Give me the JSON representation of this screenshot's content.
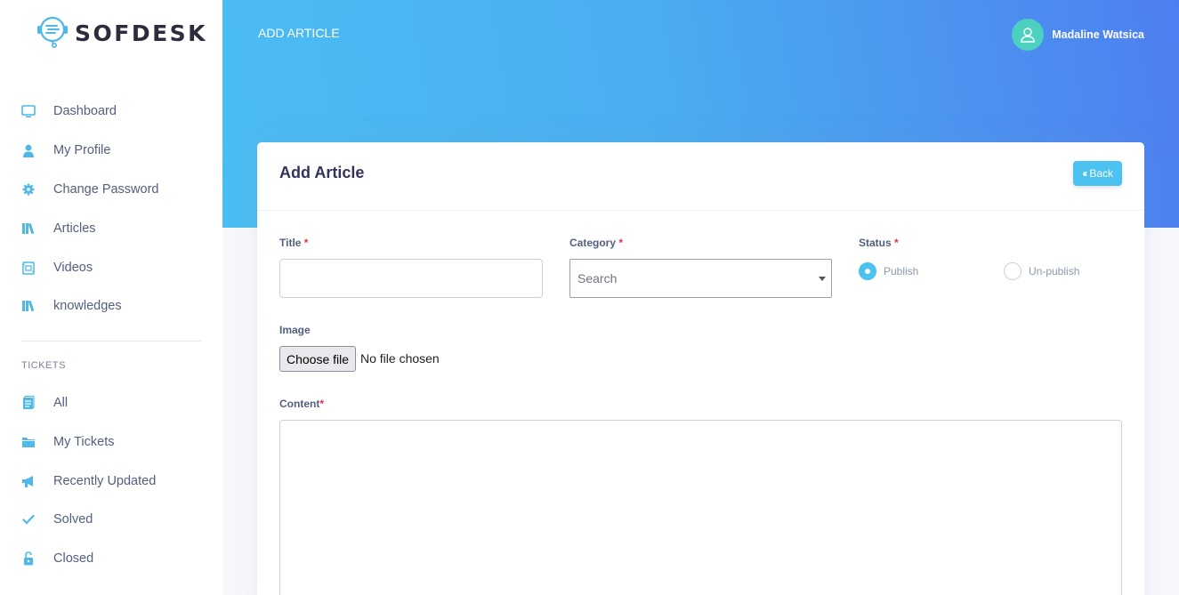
{
  "brand": {
    "name": "SOFDESK"
  },
  "sidebar": {
    "items": [
      {
        "label": "Dashboard",
        "icon": "monitor-icon"
      },
      {
        "label": "My Profile",
        "icon": "user-icon"
      },
      {
        "label": "Change Password",
        "icon": "gear-icon"
      },
      {
        "label": "Articles",
        "icon": "books-icon"
      },
      {
        "label": "Videos",
        "icon": "video-icon"
      },
      {
        "label": "knowledges",
        "icon": "books-icon"
      }
    ],
    "tickets_heading": "TICKETS",
    "ticket_items": [
      {
        "label": "All",
        "icon": "document-icon"
      },
      {
        "label": "My Tickets",
        "icon": "folder-icon"
      },
      {
        "label": "Recently Updated",
        "icon": "megaphone-icon"
      },
      {
        "label": "Solved",
        "icon": "check-icon"
      },
      {
        "label": "Closed",
        "icon": "unlock-icon"
      }
    ]
  },
  "header": {
    "title": "ADD ARTICLE"
  },
  "user": {
    "name": "Madaline Watsica"
  },
  "card": {
    "title": "Add Article",
    "back_label": "Back"
  },
  "form": {
    "title_label": "Title",
    "title_value": "",
    "category_label": "Category",
    "category_placeholder": "Search",
    "status_label": "Status",
    "status_options": [
      "Publish",
      "Un-publish"
    ],
    "status_selected": "Publish",
    "image_label": "Image",
    "file_button": "Choose file",
    "file_status": "No file chosen",
    "content_label": "Content",
    "required_mark": "*"
  },
  "colors": {
    "accent": "#4bc2ef",
    "icon": "#4fb8e8",
    "required": "#e33545"
  }
}
